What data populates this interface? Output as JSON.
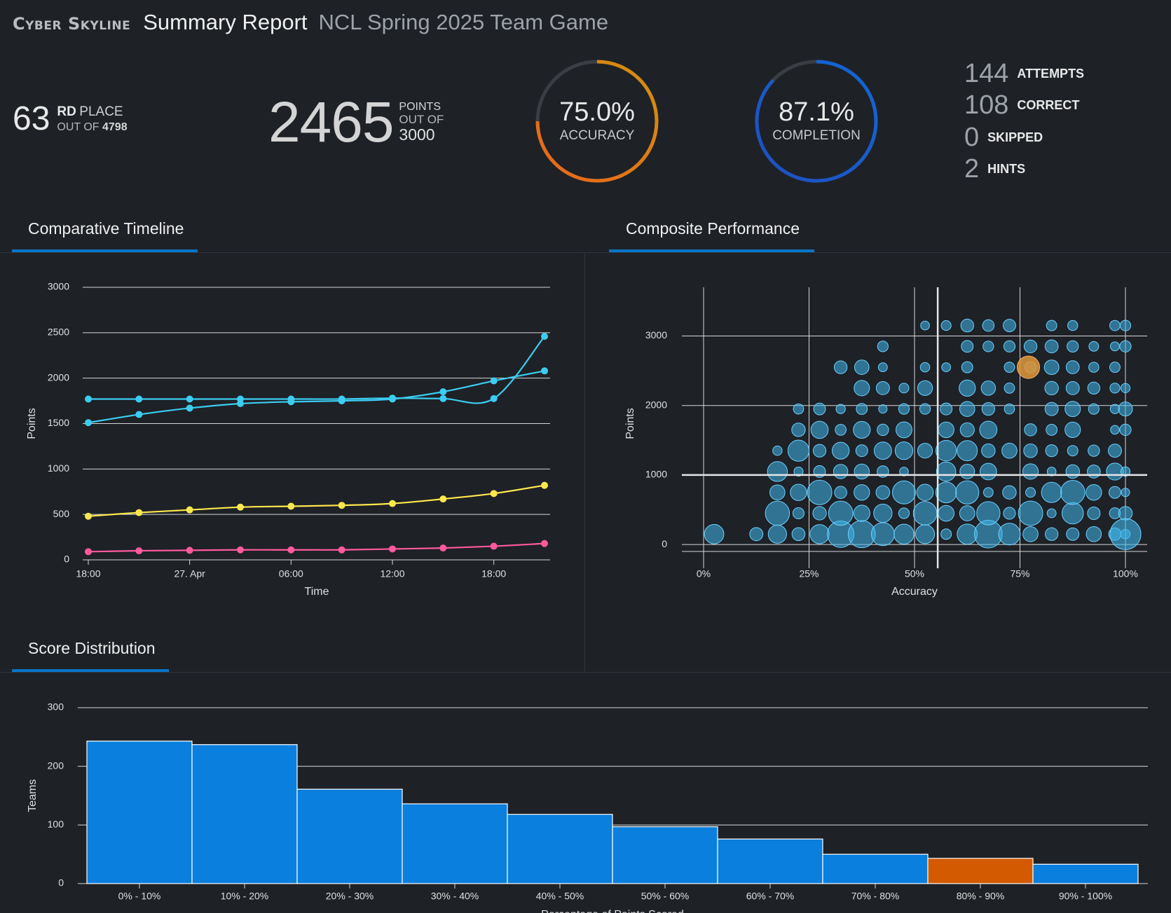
{
  "header": {
    "brand": "Cyber Skyline",
    "report_title": "Summary Report",
    "game_name": "NCL Spring 2025 Team Game"
  },
  "rank": {
    "number": "63",
    "suffix": "RD",
    "word": "PLACE",
    "out_of_label": "OUT OF",
    "out_of_value": "4798"
  },
  "points": {
    "value": "2465",
    "label": "POINTS",
    "out_of_label": "OUT OF",
    "max": "3000"
  },
  "accuracy": {
    "value": "75.0%",
    "label": "ACCURACY",
    "fraction": 0.75,
    "color_start": "#e8651a",
    "color_end": "#d4900e"
  },
  "completion": {
    "value": "87.1%",
    "label": "COMPLETION",
    "fraction": 0.871,
    "color_start": "#1f4fbf",
    "color_end": "#1167d6"
  },
  "counters": [
    {
      "num": "144",
      "label": "ATTEMPTS"
    },
    {
      "num": "108",
      "label": "CORRECT"
    },
    {
      "num": "0",
      "label": "SKIPPED"
    },
    {
      "num": "2",
      "label": "HINTS"
    }
  ],
  "tabs": {
    "timeline": "Comparative Timeline",
    "composite": "Composite Performance",
    "distribution": "Score Distribution"
  },
  "chart_data": [
    {
      "type": "line",
      "y_ticks": [
        "0",
        "500",
        "1000",
        "1500",
        "2000",
        "2500",
        "3000"
      ],
      "x_ticks": [
        "18:00",
        "27. Apr",
        "06:00",
        "12:00",
        "18:00"
      ],
      "xlabel": "Time",
      "ylabel": "Points",
      "ylim": [
        0,
        3000
      ],
      "x_hours": [
        0,
        5,
        10,
        15,
        20,
        25,
        30,
        35,
        40,
        45
      ],
      "x_tick_hours": [
        0,
        10,
        20,
        30,
        40
      ],
      "series": [
        {
          "color": "#3bcdf2",
          "values": [
            1770,
            1770,
            1770,
            1770,
            1770,
            1770,
            1780,
            1775,
            1775,
            2460
          ]
        },
        {
          "color": "#3bcdf2",
          "values": [
            1510,
            1600,
            1670,
            1720,
            1740,
            1750,
            1770,
            1850,
            1970,
            2080
          ]
        },
        {
          "color": "#ffe84d",
          "values": [
            480,
            520,
            550,
            580,
            590,
            600,
            620,
            670,
            730,
            820
          ]
        },
        {
          "color": "#ff5a9d",
          "values": [
            90,
            100,
            105,
            110,
            110,
            110,
            120,
            130,
            150,
            180
          ]
        }
      ]
    },
    {
      "type": "scatter",
      "xlabel": "Accuracy",
      "ylabel": "Points",
      "x_ticks": [
        "0%",
        "25%",
        "50%",
        "75%",
        "100%"
      ],
      "y_ticks": [
        "0",
        "1000",
        "2000",
        "3000"
      ],
      "xlim": [
        0,
        100
      ],
      "ylim": [
        -220,
        3700
      ],
      "x_columns": [
        2.5,
        12.5,
        17.5,
        22.5,
        27.5,
        32.5,
        37.5,
        42.5,
        47.5,
        52.5,
        57.5,
        62.5,
        67.5,
        72.5,
        77.5,
        82.5,
        87.5,
        92.5,
        97.5,
        100
      ],
      "y_rows": [
        150,
        450,
        750,
        1050,
        1350,
        1650,
        1950,
        2250,
        2550,
        2850,
        3150
      ],
      "color": "#40b8ec",
      "highlight": {
        "x": 77,
        "y": 2550,
        "color": "#e0963a"
      },
      "ref_x": 55.5,
      "ref_y": 1000
    },
    {
      "type": "bar",
      "xlabel": "Percentage of Points Scored",
      "ylabel": "Teams",
      "categories": [
        "0% - 10%",
        "10% - 20%",
        "20% - 30%",
        "30% - 40%",
        "40% - 50%",
        "50% - 60%",
        "60% - 70%",
        "70% - 80%",
        "80% - 90%",
        "90% - 100%"
      ],
      "values": [
        243,
        237,
        161,
        136,
        118,
        97,
        76,
        50,
        43,
        33
      ],
      "y_ticks": [
        "0",
        "100",
        "200",
        "300"
      ],
      "ylim": [
        0,
        300
      ],
      "color": "#0a7fdd",
      "highlight_index": 8,
      "highlight_color": "#d35a00"
    }
  ]
}
